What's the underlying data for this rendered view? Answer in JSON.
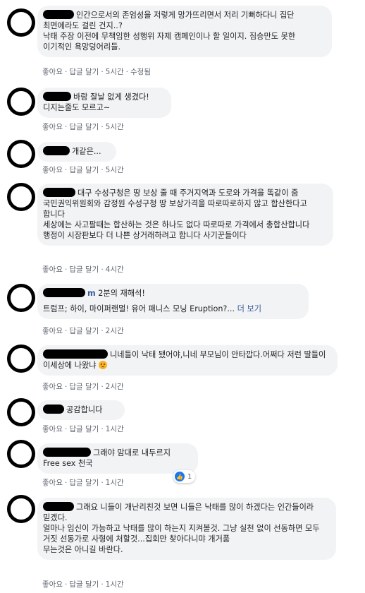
{
  "actions": {
    "like": "좋아요",
    "reply": "답글 달기",
    "dot": "·"
  },
  "comments": [
    {
      "text": "인간으로서의 존엄성을 저렇게 망가뜨리면서 저리 기뻐하다니 집단 최면에라도 걸린 건지..?\n낙태 주장 이전에 무책임한 성행위 자제 캠페인이나 할 일이지. 짐승만도 못한 이기적인 욕망덩어리들.",
      "time": "5시간",
      "edited": "수정됨"
    },
    {
      "text": "바람 잘날 없게 생겼다!\n디지는줄도 모르고~",
      "time": "5시간"
    },
    {
      "text": "개같은...",
      "time": "5시간"
    },
    {
      "text": "대구 수성구청은 땅 보상 줄 때 주거지역과 도로와 가격을 똑같이 줌 국민권익위원회와 감정원 수성구청 땅 보상가격을 따로따로하지 않고 합산한다고 합니다\n세상에는 사고팔때는 합산하는 것은 하나도 없다 따로따로 가격에서 총합산합니다 행정이 시장판보다 더 나쁜 상거래하려고 합니다 사기꾼들이다",
      "time": "4시간"
    },
    {
      "name_suffix": "m",
      "text": "2분의 재해석!",
      "text2": "트럼프; 하이, 마이퍼랜멀! 유어 패니스 모닝 Eruption?...",
      "see_more": "더 보기",
      "time": "2시간"
    },
    {
      "text": "니네들이 낙태 됐어야,니네 부모님이 안타깝다.어쩌다 저런 딸들이 이세상에 나왔냐",
      "time": "2시간"
    },
    {
      "text": "공감합니다",
      "time": "1시간"
    },
    {
      "text": "그래야 맘대로 내두르지\nFree sex 천국",
      "time": "1시간",
      "reaction_count": "1"
    },
    {
      "text": "그래요 니들이 개난리친것 보면 니들은 낙태를 많이 하겠다는 인간들이라 믿겠다.\n얼마나 임신이 가능하고 낙태를 많이 하는지 지켜볼것. 그냥 실천 없이 선동하면 모두 거짓 선동가로 사형에 처할것...집회만 찾아다니먀 개거품\n무는것은 아니길 바란다.",
      "time": "1시간"
    }
  ]
}
